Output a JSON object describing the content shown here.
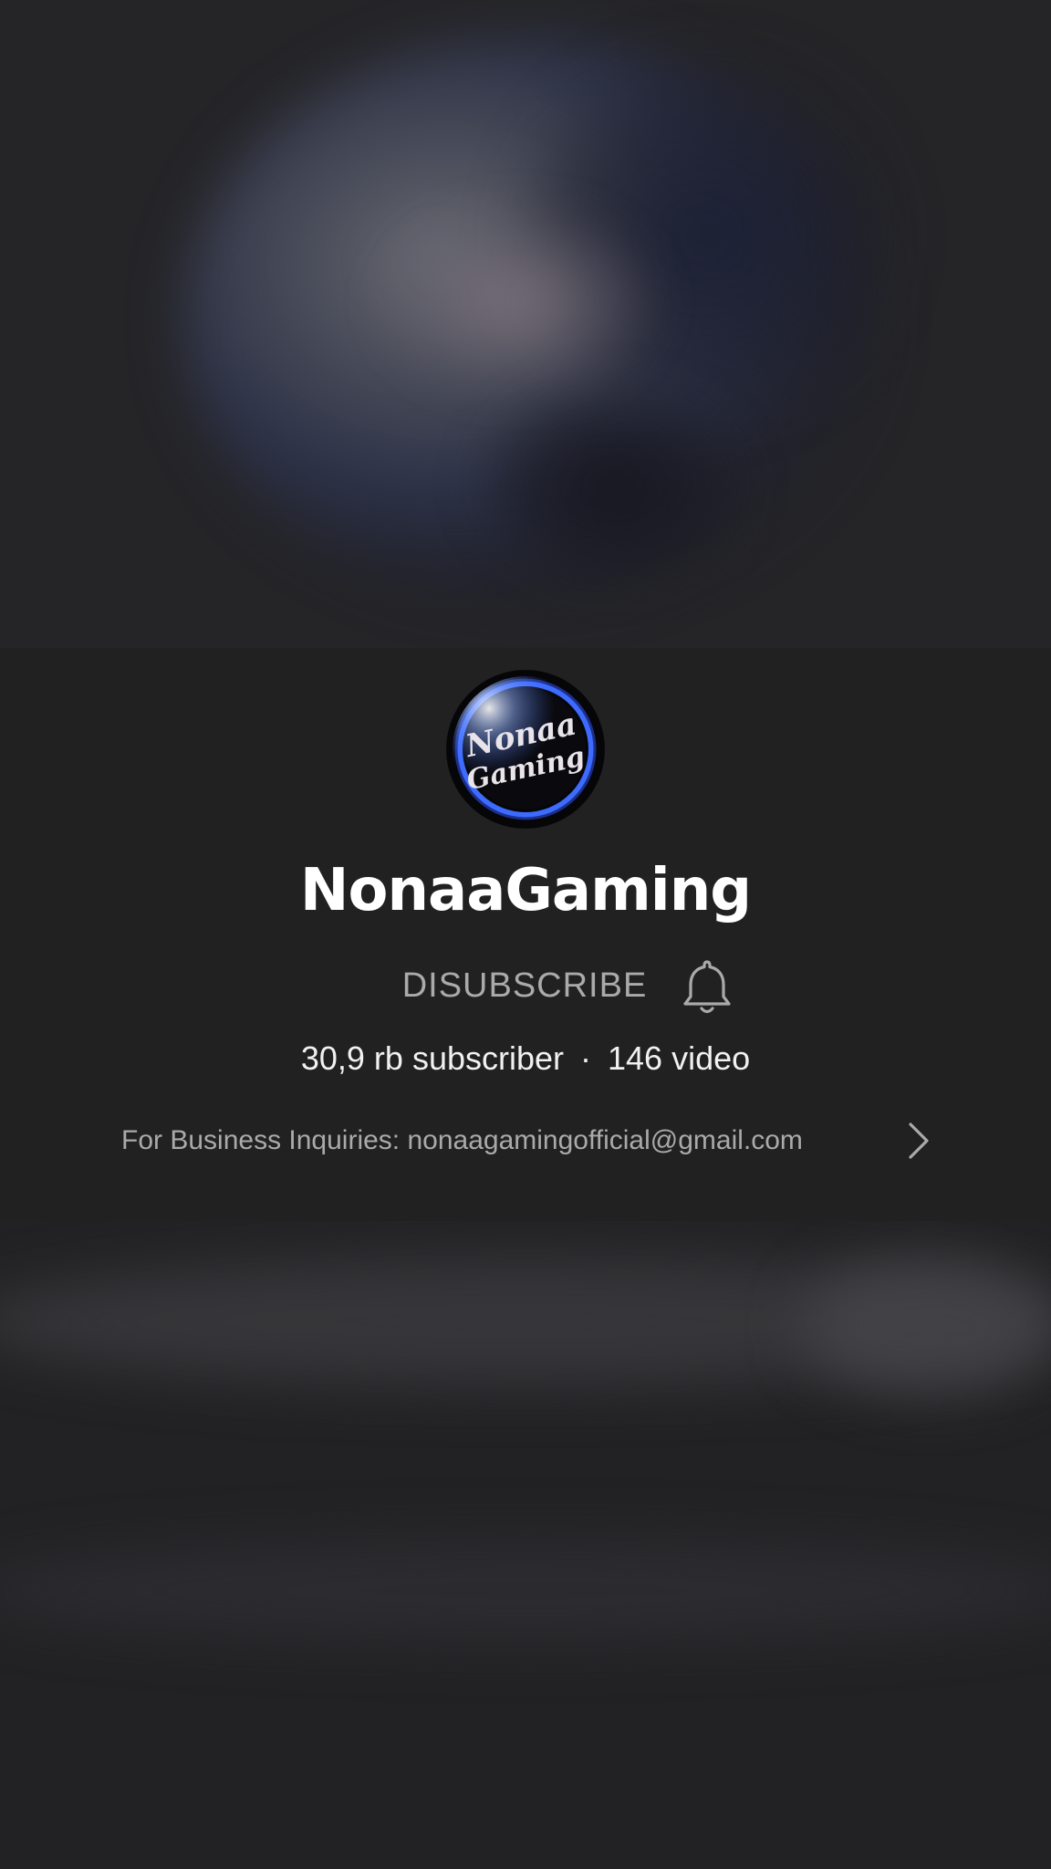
{
  "channel": {
    "name": "NonaaGaming",
    "avatar_text": "Nonaa Gaming",
    "unsubscribe_label": "DISUBSCRIBE",
    "subscriber_count": "30,9 rb subscriber",
    "separator": "·",
    "video_count": "146 video",
    "description": "For Business Inquiries: nonaagamingofficial@gmail.com"
  },
  "icons": {
    "notification": "bell-icon",
    "more": "chevron-right-icon"
  },
  "colors": {
    "background": "#212121",
    "primary_text": "#ffffff",
    "secondary_text": "#aaaaaa",
    "avatar_ring": "#3d6bff"
  }
}
